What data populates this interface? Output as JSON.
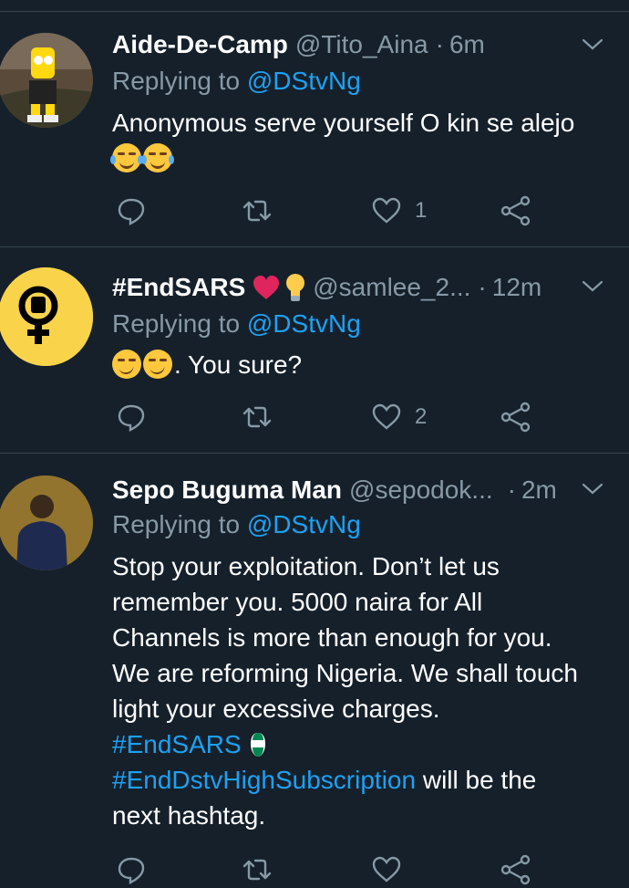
{
  "tweets": [
    {
      "name": "Aide-De-Camp",
      "handle": "@Tito_Aina",
      "time": "6m",
      "replying_prefix": "Replying to",
      "replying_to": "@DStvNg",
      "text": "Anonymous serve yourself O kin se alejo",
      "reply_count": "",
      "retweet_count": "",
      "like_count": "1"
    },
    {
      "name": "#EndSARS",
      "handle": "@samlee_2...",
      "time": "12m",
      "replying_prefix": "Replying to",
      "replying_to": "@DStvNg",
      "text": ". You sure?",
      "reply_count": "",
      "retweet_count": "",
      "like_count": "2"
    },
    {
      "name": "Sepo Buguma Man",
      "handle": "@sepodok...",
      "time": "2m",
      "replying_prefix": "Replying to",
      "replying_to": "@DStvNg",
      "text_lines": [
        "Stop your exploitation. Don’t let us",
        "remember you. 5000 naira for All",
        "Channels is more than enough for you.",
        "We are reforming Nigeria. We shall touch",
        "light your excessive charges."
      ],
      "hashtag1": "#EndSARS",
      "hashtag2": "#EndDstvHighSubscription",
      "text_after_hashtag2": " will be the",
      "text_last_line": "next hashtag."
    }
  ],
  "icons": {
    "reply": "reply-icon",
    "retweet": "retweet-icon",
    "like": "heart-icon",
    "share": "share-icon",
    "menu": "chevron-down-icon"
  },
  "colors": {
    "background": "#15202b",
    "secondary_text": "#8899a6",
    "link": "#1da1f2",
    "divider": "#38444d"
  }
}
